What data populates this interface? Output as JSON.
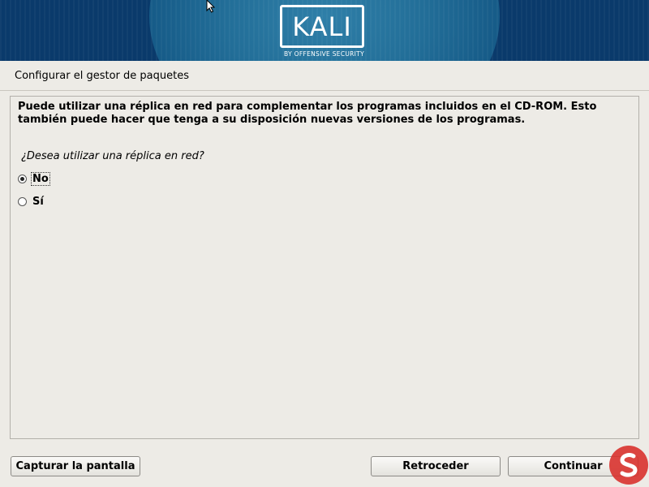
{
  "banner": {
    "logo_text": "KALI",
    "logo_subtitle": "BY OFFENSIVE SECURITY"
  },
  "page": {
    "title": "Configurar el gestor de paquetes"
  },
  "content": {
    "description": "Puede utilizar una réplica en red para complementar los programas incluidos en el CD-ROM. Esto también puede hacer que tenga a su disposición nuevas versiones de los programas.",
    "question": "¿Desea utilizar una réplica en red?",
    "options": [
      {
        "label": "No",
        "selected": true
      },
      {
        "label": "Sí",
        "selected": false
      }
    ]
  },
  "buttons": {
    "screenshot": "Capturar la pantalla",
    "back": "Retroceder",
    "continue": "Continuar"
  },
  "colors": {
    "banner_bg": "#0a3a6b",
    "background": "#edebe6",
    "watermark_red": "#d8322e"
  },
  "icons": {
    "cursor": "mouse-pointer-icon",
    "watermark": "solvetic-watermark-icon"
  }
}
